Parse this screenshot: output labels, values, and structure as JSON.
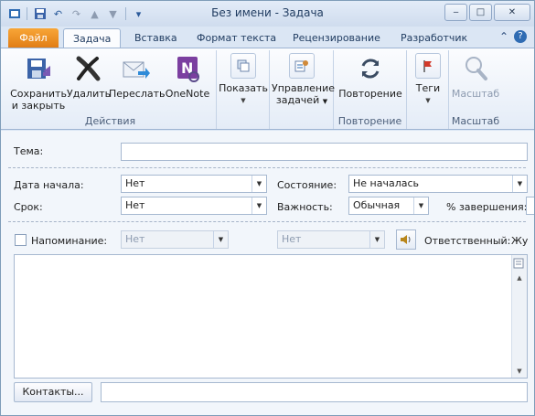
{
  "window": {
    "title": "Без имени  -  Задача",
    "controls": {
      "minimize": "‒",
      "maximize": "□",
      "close": "✕"
    }
  },
  "qat": {
    "icons": [
      "save-icon",
      "undo-icon",
      "redo-icon",
      "up-icon",
      "down-icon",
      "customize-icon"
    ]
  },
  "tabs": {
    "file": "Файл",
    "items": [
      "Задача",
      "Вставка",
      "Формат текста",
      "Рецензирование",
      "Разработчик"
    ],
    "active": "Задача",
    "right": {
      "help": "?",
      "collapse": "⌃"
    }
  },
  "ribbon": {
    "actions": {
      "label": "Действия",
      "save_close": "Сохранить\nи закрыть",
      "delete": "Удалить",
      "forward": "Переслать",
      "onenote": "OneNote"
    },
    "show": {
      "label": "Показать"
    },
    "manage": {
      "label": "Управление\nзадачей"
    },
    "recurrence": {
      "button": "Повторение",
      "group": "Повторение"
    },
    "tags": {
      "label": "Теги"
    },
    "zoom": {
      "button": "Масштаб",
      "group": "Масштаб"
    }
  },
  "form": {
    "subject_label": "Тема:",
    "subject_value": "",
    "start_label": "Дата начала:",
    "start_value": "Нет",
    "due_label": "Срок:",
    "due_value": "Нет",
    "status_label": "Состояние:",
    "status_value": "Не началась",
    "priority_label": "Важность:",
    "priority_value": "Обычная",
    "percent_label": "% завершения:",
    "reminder_label": "Напоминание:",
    "reminder_date": "Нет",
    "reminder_time": "Нет",
    "owner_label": "Ответственный:",
    "owner_value": "Жу",
    "contacts_button": "Контакты...",
    "contacts_value": ""
  }
}
